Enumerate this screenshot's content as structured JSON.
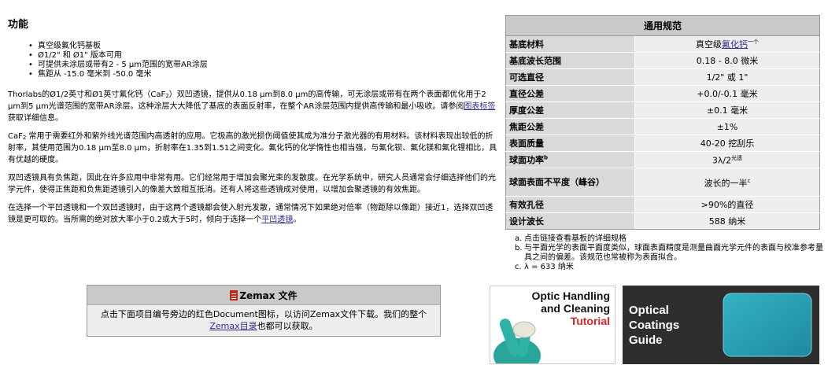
{
  "features": {
    "heading": "功能",
    "bullets": [
      "真空级氟化钙基板",
      "Ø1/2\" 和 Ø1\" 版本可用",
      "可提供未涂层或带有2 - 5 µm范围的宽带AR涂层",
      "焦距从 -15.0 毫米到 -50.0 毫米"
    ],
    "p1": {
      "a": "Thorlabs的Ø1/2英寸和Ø1英寸氟化钙（CaF",
      "sub": "2",
      "b": "）双凹透镜，提供从0.18 µm到8.0 µm的高传输，可无涂层或带有在两个表面都优化用于2 µm到5 µm光谱范围的宽带AR涂层。这种涂层大大降低了基底的表面反射率，在整个AR涂层范围内提供高传输和最小吸收。请参阅",
      "link": "图表标签",
      "c": "获取详细信息。"
    },
    "p2": {
      "a": "CaF",
      "sub": "2",
      "b": " 常用于需要红外和紫外线光谱范围内高透射的应用。它极高的激光损伤阈值使其成为准分子激光器的有用材料。该材料表现出较低的折射率，其使用范围为0.18 µm至8.0 µm，折射率在1.35到1.51之间变化。氟化钙的化学惰性也相当强，与氟化钡、氟化镁和氟化锂相比，具有优越的硬度。"
    },
    "p3": "双凹透镜具有负焦距，因此在许多应用中非常有用。它们经常用于增加会聚光束的发散度。在光学系统中，研究人员通常会仔细选择他们的光学元件，使得正焦距和负焦距透镜引入的像差大致相互抵消。还有人将这些透镜成对使用，以增加会聚透镜的有效焦距。",
    "p4": {
      "a": "在选择一个平凹透镜和一个双凹透镜时，由于这两个透镜都会使入射光发散，通常情况下如果绝对倍率（物距除以像距）接近1，选择双凹透镜是更可取的。当所需的绝对放大率小于0.2或大于5时，倾向于选择一个",
      "link": "平凹透镜",
      "b": "。"
    }
  },
  "specs": {
    "title": "通用规范",
    "rows": [
      {
        "label": "基底材料",
        "pre": "真空级",
        "link": "氟化钙",
        "post": "一个"
      },
      {
        "label": "基底波长范围",
        "value": "0.18 - 8.0 微米"
      },
      {
        "label": "可选直径",
        "value": "1/2\" 或 1\""
      },
      {
        "label": "直径公差",
        "value": "+0.0/-0.1 毫米"
      },
      {
        "label": "厚度公差",
        "value": "±0.1 毫米"
      },
      {
        "label": "焦距公差",
        "value": "±1%"
      },
      {
        "label": "表面质量",
        "value": "40-20 挖刮乐"
      },
      {
        "label": "球面功率",
        "label_sup": "b",
        "value": "3λ/2",
        "value_sup": "光遗"
      },
      {
        "label": "球面表面不平度（峰谷）",
        "value": "波长的一半",
        "value_sup": "c"
      },
      {
        "label": "有效孔径",
        "value": ">90%的直径"
      },
      {
        "label": "设计波长",
        "value": "588 纳米"
      }
    ],
    "notes": [
      {
        "mark": "a.",
        "text": "点击链接查看基板的详细规格"
      },
      {
        "mark": "b.",
        "text": "与平面光学的表面平面度类似，球面表面精度是测量曲面光学元件的表面与校准参考量具之间的偏差。该规范也常被称为表面拟合。"
      },
      {
        "mark": "c.",
        "text": "λ = 633 纳米"
      }
    ]
  },
  "zemax": {
    "title": "Zemax 文件",
    "line": "点击下面项目编号旁边的红色Document图标，以访问Zemax文件下载。我们的整个",
    "link": "Zemax目录",
    "tail": "也都可以获取。"
  },
  "tiles": {
    "handling": {
      "line1": "Optic Handling",
      "line2": "and Cleaning",
      "line3": "Tutorial"
    },
    "coatings": {
      "line1": "Optical",
      "line2": "Coatings",
      "line3": "Guide"
    }
  },
  "colors": {
    "accent_link": "#2b2e8f",
    "header_gray": "#c9c9c9",
    "icon_red": "#c0281c",
    "tutorial_red": "#d22222"
  }
}
